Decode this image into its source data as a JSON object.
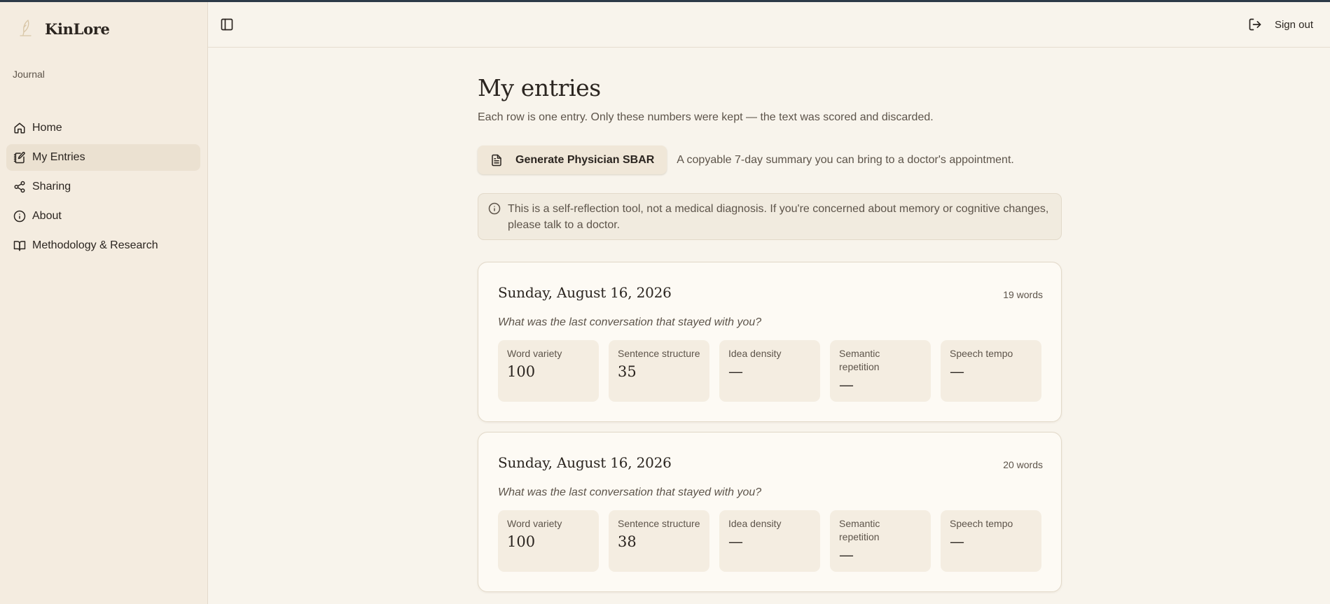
{
  "app": {
    "name": "KinLore"
  },
  "sidebar": {
    "group_label": "Journal",
    "items": [
      {
        "label": "Home",
        "icon": "home-icon"
      },
      {
        "label": "My Entries",
        "icon": "notebook-pen-icon",
        "active": true
      },
      {
        "label": "Sharing",
        "icon": "share-icon"
      },
      {
        "label": "About",
        "icon": "info-icon"
      },
      {
        "label": "Methodology & Research",
        "icon": "book-open-icon"
      }
    ]
  },
  "header": {
    "sign_out_label": "Sign out"
  },
  "main": {
    "title": "My entries",
    "subtitle": "Each row is one entry. Only these numbers were kept — the text was scored and discarded.",
    "sbar_button_label": "Generate Physician SBAR",
    "sbar_description": "A copyable 7-day summary you can bring to a doctor's appointment.",
    "notice": "This is a self-reflection tool, not a medical diagnosis. If you're concerned about memory or cognitive changes, please talk to a doctor."
  },
  "entries": [
    {
      "date": "Sunday, August 16, 2026",
      "words": "19 words",
      "prompt": "What was the last conversation that stayed with you?",
      "metrics": [
        {
          "label": "Word variety",
          "value": "100"
        },
        {
          "label": "Sentence structure",
          "value": "35"
        },
        {
          "label": "Idea density",
          "value": "—"
        },
        {
          "label": "Semantic repetition",
          "value": "—"
        },
        {
          "label": "Speech tempo",
          "value": "—"
        }
      ]
    },
    {
      "date": "Sunday, August 16, 2026",
      "words": "20 words",
      "prompt": "What was the last conversation that stayed with you?",
      "metrics": [
        {
          "label": "Word variety",
          "value": "100"
        },
        {
          "label": "Sentence structure",
          "value": "38"
        },
        {
          "label": "Idea density",
          "value": "—"
        },
        {
          "label": "Semantic repetition",
          "value": "—"
        },
        {
          "label": "Speech tempo",
          "value": "—"
        }
      ]
    }
  ],
  "colors": {
    "accent_dark": "#2c3a48",
    "sidebar_bg": "#f4ece0",
    "page_bg": "#f8f4ec",
    "card_bg": "#fdfaf4",
    "metric_bg": "#f4ede1"
  }
}
